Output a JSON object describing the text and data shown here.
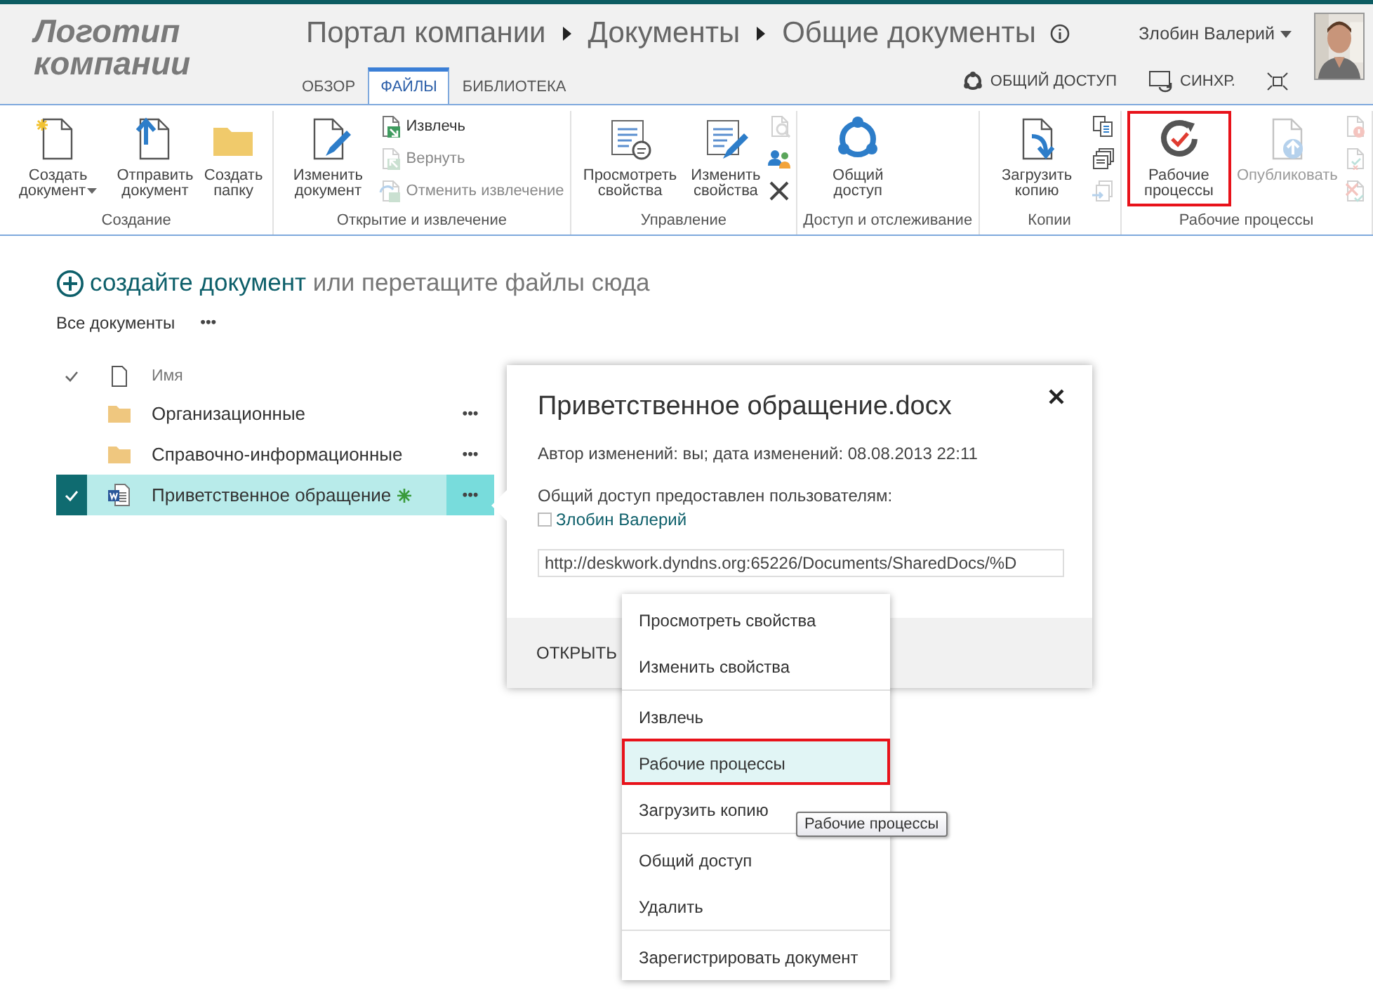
{
  "header": {
    "logo": "Логотип компании",
    "breadcrumb": [
      "Портал компании",
      "Документы",
      "Общие документы"
    ],
    "user": "Злобин Валерий"
  },
  "tabs": [
    {
      "label": "ОБЗОР",
      "selected": false
    },
    {
      "label": "ФАЙЛЫ",
      "selected": true
    },
    {
      "label": "БИБЛИОТЕКА",
      "selected": false
    }
  ],
  "actions": [
    {
      "label": "ОБЩИЙ ДОСТУП"
    },
    {
      "label": "СИНХР."
    }
  ],
  "ribbon": {
    "groups": [
      {
        "label": "Создание",
        "items": [
          {
            "kind": "large",
            "label": "Создать документ",
            "dropdown": true,
            "disabled": false,
            "highlighted": false
          },
          {
            "kind": "large",
            "label": "Отправить документ",
            "dropdown": false,
            "disabled": false,
            "highlighted": false
          },
          {
            "kind": "large",
            "label": "Создать папку",
            "dropdown": false,
            "disabled": false,
            "highlighted": false
          }
        ]
      },
      {
        "label": "Открытие и извлечение",
        "items": [
          {
            "kind": "large",
            "label": "Изменить документ",
            "dropdown": false,
            "disabled": false,
            "highlighted": false
          },
          {
            "kind": "stack",
            "buttons": [
              {
                "label": "Извлечь",
                "disabled": false
              },
              {
                "label": "Вернуть",
                "disabled": true
              },
              {
                "label": "Отменить извлечение",
                "disabled": true
              }
            ]
          }
        ]
      },
      {
        "label": "Управление",
        "items": [
          {
            "kind": "large",
            "label": "Просмотреть свойства",
            "dropdown": false,
            "disabled": false,
            "highlighted": false
          },
          {
            "kind": "large",
            "label": "Изменить свойства",
            "dropdown": false,
            "disabled": false,
            "highlighted": false
          },
          {
            "kind": "stack",
            "buttons": [
              {
                "disabled": true
              },
              {
                "disabled": false
              },
              {
                "disabled": false
              }
            ]
          }
        ]
      },
      {
        "label": "Доступ и отслеживание",
        "items": [
          {
            "kind": "large",
            "label": "Общий доступ",
            "dropdown": false,
            "disabled": false,
            "highlighted": false
          }
        ]
      },
      {
        "label": "Копии",
        "items": [
          {
            "kind": "large",
            "label": "Загрузить копию",
            "dropdown": false,
            "disabled": false,
            "highlighted": false
          },
          {
            "kind": "stack",
            "buttons": [
              {
                "disabled": false
              },
              {
                "disabled": false
              },
              {
                "disabled": true
              }
            ]
          }
        ]
      },
      {
        "label": "Рабочие процессы",
        "items": [
          {
            "kind": "large",
            "label": "Рабочие процессы",
            "dropdown": false,
            "disabled": false,
            "highlighted": true
          },
          {
            "kind": "large",
            "label": "Опубликовать",
            "dropdown": false,
            "disabled": true,
            "highlighted": false
          },
          {
            "kind": "stack",
            "buttons": [
              {
                "disabled": true
              },
              {
                "disabled": true
              },
              {
                "disabled": true
              }
            ]
          }
        ]
      }
    ]
  },
  "prompt": {
    "link": "создайте документ",
    "text": "или перетащите файлы сюда"
  },
  "view": {
    "label": "Все документы",
    "more": "•••"
  },
  "list": {
    "column": "Имя",
    "rows": [
      {
        "name": "Организационные",
        "kind": "folder",
        "selected": false,
        "new": false,
        "more": "•••"
      },
      {
        "name": "Справочно-информационные",
        "kind": "folder",
        "selected": false,
        "new": false,
        "more": "•••"
      },
      {
        "name": "Приветственное обращение",
        "kind": "document",
        "selected": true,
        "new": true,
        "more": "•••"
      }
    ]
  },
  "callout": {
    "title": "Приветственное обращение.docx",
    "modified": "Автор изменений: вы; дата изменений: 08.08.2013 22:11",
    "shared_label": "Общий доступ предоставлен пользователям:",
    "users": [
      {
        "name": "Злобин Валерий",
        "checked": false
      }
    ],
    "url": "http://deskwork.dyndns.org:65226/Documents/SharedDocs/%D",
    "open": "ОТКРЫТЬ"
  },
  "menu": {
    "sections": [
      {
        "items": [
          {
            "label": "Просмотреть свойства",
            "highlighted": false
          },
          {
            "label": "Изменить свойства",
            "highlighted": false
          }
        ]
      },
      {
        "items": [
          {
            "label": "Извлечь",
            "highlighted": false
          },
          {
            "label": "Рабочие процессы",
            "highlighted": true
          },
          {
            "label": "Загрузить копию",
            "highlighted": false
          }
        ]
      },
      {
        "items": [
          {
            "label": "Общий доступ",
            "highlighted": false
          },
          {
            "label": "Удалить",
            "highlighted": false
          }
        ]
      },
      {
        "items": [
          {
            "label": "Зарегистрировать документ",
            "highlighted": false
          }
        ]
      }
    ]
  },
  "tooltip": "Рабочие процессы"
}
